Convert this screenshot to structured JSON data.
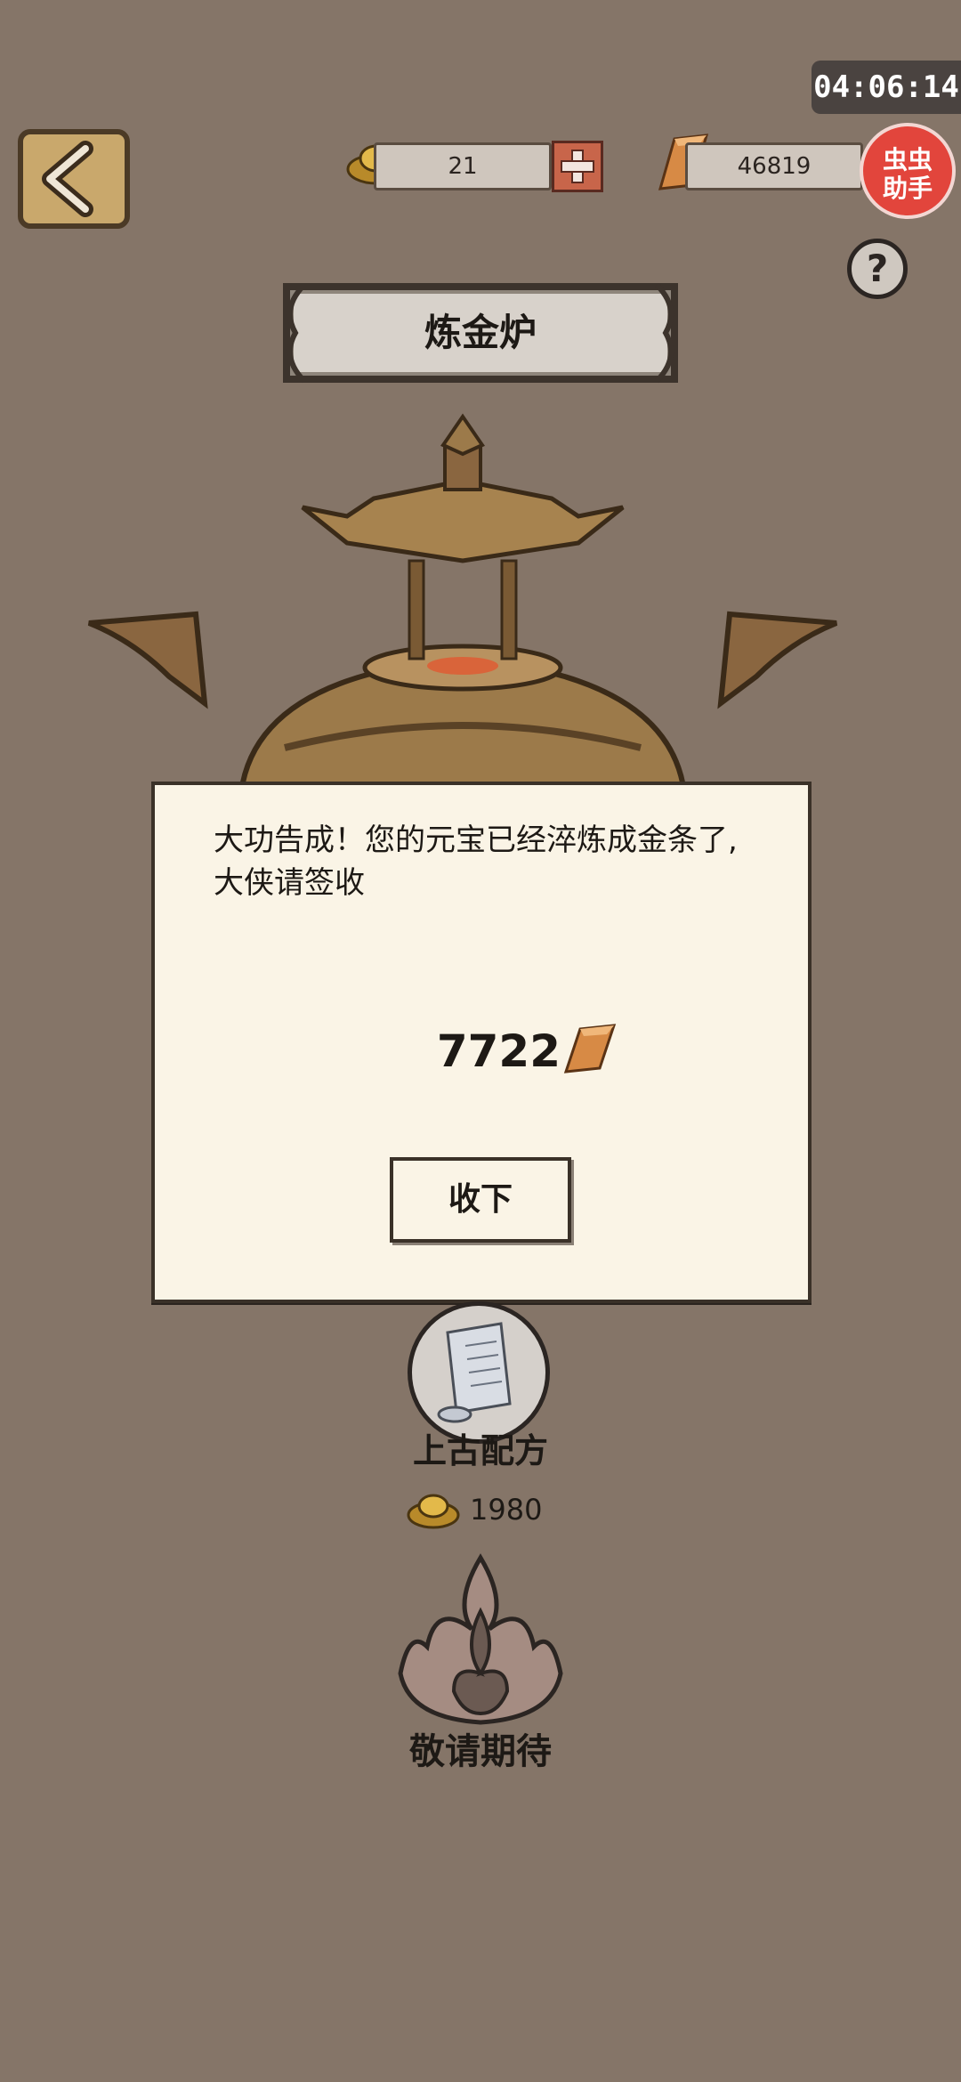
{
  "status": {
    "timer": "04:06:14"
  },
  "header": {
    "title": "炼金炉",
    "yuanbao_count": "21",
    "gold_bar_count": "46819",
    "helper_badge": "虫虫\n助手",
    "help_label": "?"
  },
  "dialog": {
    "message": "大功告成！您的元宝已经淬炼成金条了,大侠请签收",
    "reward_value": "7722",
    "accept_label": "收下"
  },
  "recipe": {
    "label": "上古配方",
    "cost": "1980"
  },
  "coming_soon": {
    "label": "敬请期待"
  },
  "colors": {
    "background": "#857568",
    "dialog_bg": "#faf4e6",
    "helper_red": "#e2453c",
    "plus_red": "#c8654a",
    "gold": "#c9a86c"
  }
}
